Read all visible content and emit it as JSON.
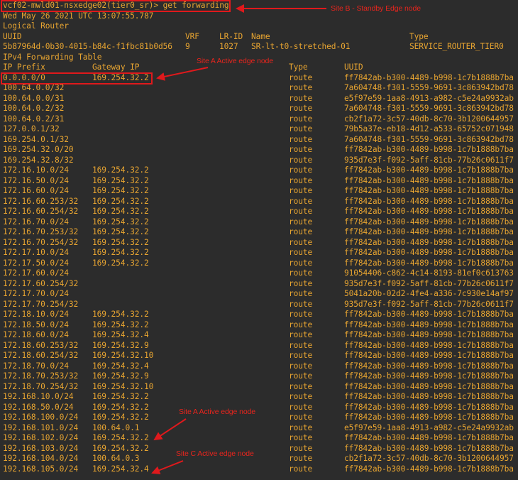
{
  "prompt": "vcf02-mwld01-nsxedge02(tier0_sr)> get forwarding",
  "timestamp": "Wed May 26 2021 UTC 13:07:55.787",
  "section_title": "Logical Router",
  "router_header": {
    "uuid": "UUID",
    "vrf": "VRF",
    "lrid": "LR-ID",
    "name": "Name",
    "type": "Type"
  },
  "router": {
    "uuid": "5b87964d-0b30-4015-b84c-f1fbc81b0d56",
    "vrf": "9",
    "lrid": "1027",
    "name": "SR-lt-t0-stretched-01",
    "type": "SERVICE_ROUTER_TIER0"
  },
  "table_title": "IPv4 Forwarding Table",
  "columns": [
    "IP Prefix",
    "Gateway IP",
    "Type",
    "UUID"
  ],
  "rows": [
    [
      "0.0.0.0/0",
      "169.254.32.2",
      "route",
      "ff7842ab-b300-4489-b998-1c7b1888b7ba"
    ],
    [
      "100.64.0.0/32",
      "",
      "route",
      "7a604748-f301-5559-9691-3c863942bd78"
    ],
    [
      "100.64.0.0/31",
      "",
      "route",
      "e5f97e59-1aa8-4913-a982-c5e24a9932ab"
    ],
    [
      "100.64.0.2/32",
      "",
      "route",
      "7a604748-f301-5559-9691-3c863942bd78"
    ],
    [
      "100.64.0.2/31",
      "",
      "route",
      "cb2f1a72-3c57-40db-8c70-3b1200644957"
    ],
    [
      "127.0.0.1/32",
      "",
      "route",
      "79b5a37e-eb18-4d12-a533-65752c071948"
    ],
    [
      "169.254.0.1/32",
      "",
      "route",
      "7a604748-f301-5559-9691-3c863942bd78"
    ],
    [
      "169.254.32.0/20",
      "",
      "route",
      "ff7842ab-b300-4489-b998-1c7b1888b7ba"
    ],
    [
      "169.254.32.8/32",
      "",
      "route",
      "935d7e3f-f092-5aff-81cb-77b26c0611f7"
    ],
    [
      "172.16.10.0/24",
      "169.254.32.2",
      "route",
      "ff7842ab-b300-4489-b998-1c7b1888b7ba"
    ],
    [
      "172.16.50.0/24",
      "169.254.32.2",
      "route",
      "ff7842ab-b300-4489-b998-1c7b1888b7ba"
    ],
    [
      "172.16.60.0/24",
      "169.254.32.2",
      "route",
      "ff7842ab-b300-4489-b998-1c7b1888b7ba"
    ],
    [
      "172.16.60.253/32",
      "169.254.32.2",
      "route",
      "ff7842ab-b300-4489-b998-1c7b1888b7ba"
    ],
    [
      "172.16.60.254/32",
      "169.254.32.2",
      "route",
      "ff7842ab-b300-4489-b998-1c7b1888b7ba"
    ],
    [
      "172.16.70.0/24",
      "169.254.32.2",
      "route",
      "ff7842ab-b300-4489-b998-1c7b1888b7ba"
    ],
    [
      "172.16.70.253/32",
      "169.254.32.2",
      "route",
      "ff7842ab-b300-4489-b998-1c7b1888b7ba"
    ],
    [
      "172.16.70.254/32",
      "169.254.32.2",
      "route",
      "ff7842ab-b300-4489-b998-1c7b1888b7ba"
    ],
    [
      "172.17.10.0/24",
      "169.254.32.2",
      "route",
      "ff7842ab-b300-4489-b998-1c7b1888b7ba"
    ],
    [
      "172.17.50.0/24",
      "169.254.32.2",
      "route",
      "ff7842ab-b300-4489-b998-1c7b1888b7ba"
    ],
    [
      "172.17.60.0/24",
      "",
      "route",
      "91054406-c862-4c14-8193-81ef0c613763"
    ],
    [
      "172.17.60.254/32",
      "",
      "route",
      "935d7e3f-f092-5aff-81cb-77b26c0611f7"
    ],
    [
      "172.17.70.0/24",
      "",
      "route",
      "5041a20b-02d2-4fe4-a336-7c930e14af97"
    ],
    [
      "172.17.70.254/32",
      "",
      "route",
      "935d7e3f-f092-5aff-81cb-77b26c0611f7"
    ],
    [
      "172.18.10.0/24",
      "169.254.32.2",
      "route",
      "ff7842ab-b300-4489-b998-1c7b1888b7ba"
    ],
    [
      "172.18.50.0/24",
      "169.254.32.2",
      "route",
      "ff7842ab-b300-4489-b998-1c7b1888b7ba"
    ],
    [
      "172.18.60.0/24",
      "169.254.32.4",
      "route",
      "ff7842ab-b300-4489-b998-1c7b1888b7ba"
    ],
    [
      "172.18.60.253/32",
      "169.254.32.9",
      "route",
      "ff7842ab-b300-4489-b998-1c7b1888b7ba"
    ],
    [
      "172.18.60.254/32",
      "169.254.32.10",
      "route",
      "ff7842ab-b300-4489-b998-1c7b1888b7ba"
    ],
    [
      "172.18.70.0/24",
      "169.254.32.4",
      "route",
      "ff7842ab-b300-4489-b998-1c7b1888b7ba"
    ],
    [
      "172.18.70.253/32",
      "169.254.32.9",
      "route",
      "ff7842ab-b300-4489-b998-1c7b1888b7ba"
    ],
    [
      "172.18.70.254/32",
      "169.254.32.10",
      "route",
      "ff7842ab-b300-4489-b998-1c7b1888b7ba"
    ],
    [
      "192.168.10.0/24",
      "169.254.32.2",
      "route",
      "ff7842ab-b300-4489-b998-1c7b1888b7ba"
    ],
    [
      "192.168.50.0/24",
      "169.254.32.2",
      "route",
      "ff7842ab-b300-4489-b998-1c7b1888b7ba"
    ],
    [
      "192.168.100.0/24",
      "169.254.32.2",
      "route",
      "ff7842ab-b300-4489-b998-1c7b1888b7ba"
    ],
    [
      "192.168.101.0/24",
      "100.64.0.1",
      "route",
      "e5f97e59-1aa8-4913-a982-c5e24a9932ab"
    ],
    [
      "192.168.102.0/24",
      "169.254.32.2",
      "route",
      "ff7842ab-b300-4489-b998-1c7b1888b7ba"
    ],
    [
      "192.168.103.0/24",
      "169.254.32.2",
      "route",
      "ff7842ab-b300-4489-b998-1c7b1888b7ba"
    ],
    [
      "192.168.104.0/24",
      "100.64.0.3",
      "route",
      "cb2f1a72-3c57-40db-8c70-3b1200644957"
    ],
    [
      "192.168.105.0/24",
      "169.254.32.4",
      "route",
      "ff7842ab-b300-4489-b998-1c7b1888b7ba"
    ]
  ],
  "annotations": {
    "site_b": "Site B - Standby Edge node",
    "site_a_top": "Site A Active edge node",
    "site_a_bottom": "Site A Active edge node",
    "site_c": "Site C Active edge node"
  },
  "colors": {
    "background": "#2c2c2c",
    "text": "#e8a531",
    "annotation": "#e0191c"
  }
}
